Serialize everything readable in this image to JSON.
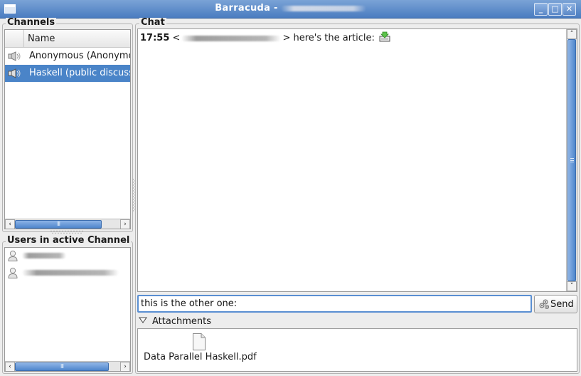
{
  "window": {
    "title": "Barracuda -"
  },
  "channels": {
    "label": "Channels",
    "column_header": "Name",
    "items": [
      {
        "label": "Anonymous (Anonymo",
        "selected": false
      },
      {
        "label": "Haskell (public discuss",
        "selected": true
      }
    ]
  },
  "users": {
    "label": "Users in active Channel"
  },
  "chat": {
    "label": "Chat",
    "messages": [
      {
        "time": "17:55",
        "open": "<",
        "close": ">",
        "text": "here's the article:"
      }
    ]
  },
  "compose": {
    "value": "this is the other one:",
    "send_label": "Send"
  },
  "attachments": {
    "label": "Attachments",
    "expanded": true,
    "files": [
      {
        "name": "Data Parallel Haskell.pdf"
      }
    ]
  },
  "icons": {
    "channel": "speaker-icon",
    "user": "person-icon",
    "attachment_link": "download-icon",
    "file": "document-icon",
    "send": "send-icon"
  },
  "colors": {
    "accent": "#4a84c8",
    "titlebar": "#5b88c7"
  }
}
